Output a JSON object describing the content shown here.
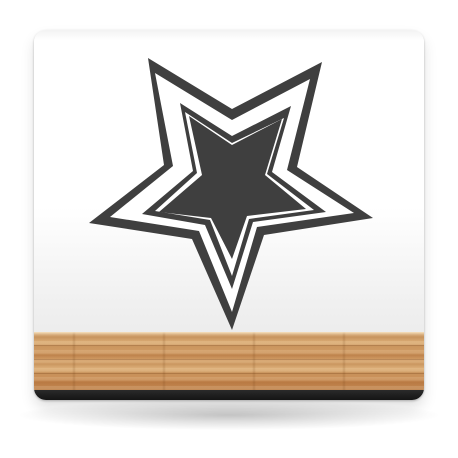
{
  "scene": {
    "graphic": "star-outline-icon",
    "colors": {
      "background": "#ffffff",
      "star": "#3f3f3f",
      "tile_top": "#ffffff",
      "tile_bottom": "#e4e4e4",
      "shelf_wood": "#c89560",
      "shelf_edge": "#1c1c1c"
    }
  }
}
